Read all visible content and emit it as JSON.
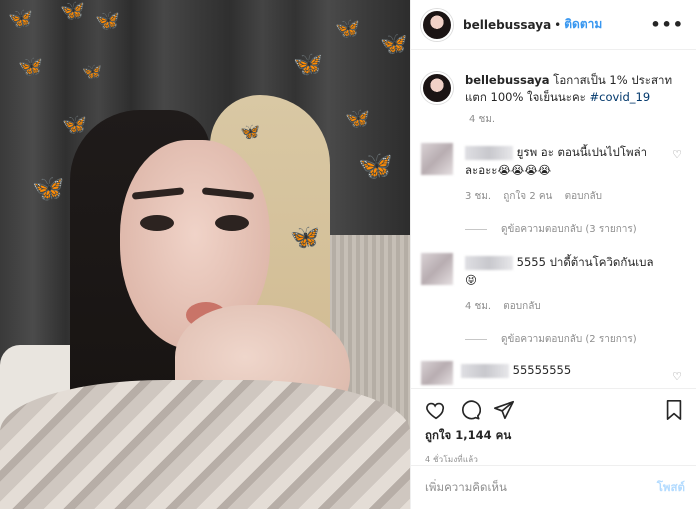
{
  "header": {
    "username": "bellebussaya",
    "separator": "•",
    "follow_label": "ติดตาม",
    "more_icon": "•••"
  },
  "caption": {
    "username": "bellebussaya",
    "text": "โอกาสเป็น 1% ประสาทแตก 100% ใจเย็นนะคะ",
    "hashtag": "#covid_19",
    "time": "4 ชม."
  },
  "comments": [
    {
      "text_line1": "ยูรพ อะ ตอนนี้เปนไปโพล่า",
      "text_line2": "ละอะะ😭😭😭😭",
      "time": "3 ชม.",
      "likes": "ถูกใจ 2 คน",
      "reply": "ตอบกลับ",
      "view_replies": "ดูข้อความตอบกลับ (3 รายการ)"
    },
    {
      "text_line1": "5555 ปาดี้ต้านโควิดกันเบล",
      "text_line2": "😝",
      "time": "4 ชม.",
      "reply": "ตอบกลับ",
      "view_replies": "ดูข้อความตอบกลับ (2 รายการ)"
    },
    {
      "text_line1": "55555555"
    }
  ],
  "actions": {
    "likes": "ถูกใจ 1,144 คน",
    "ago": "4 ชั่วโมงที่แล้ว"
  },
  "add_comment": {
    "placeholder": "เพิ่มความคิดเห็น",
    "post_label": "โพสต์"
  },
  "colors": {
    "follow": "#3897f0",
    "hashtag": "#00376b",
    "post_disabled": "#b3dbff"
  }
}
